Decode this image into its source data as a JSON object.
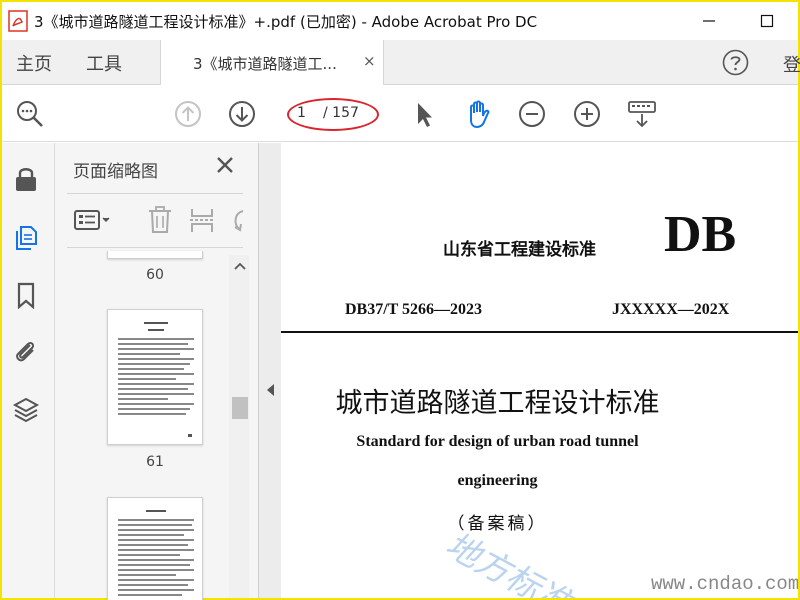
{
  "window": {
    "title": "3《城市道路隧道工程设计标准》+.pdf  (已加密)  - Adobe Acrobat Pro DC",
    "minimize_icon": "minimize-icon",
    "maximize_icon": "maximize-icon"
  },
  "tabs": {
    "home": "主页",
    "tools": "工具",
    "document": "3《城市道路隧道工...",
    "close": "×",
    "signin": "登"
  },
  "toolbar": {
    "page_current": "1",
    "page_total": "/ 157",
    "highlight_color": "#d9262d",
    "hand_color": "#1473e6"
  },
  "thumbnails_panel": {
    "title": "页面缩略图",
    "pages": [
      {
        "label": "60"
      },
      {
        "label": "61"
      },
      {
        "label": ""
      }
    ]
  },
  "document": {
    "standard_cn": "山东省工程建设标准",
    "db": "DB",
    "code_left": "DB37/T 5266—2023",
    "code_right": "JXXXXX—202X",
    "title_cn": "城市道路隧道工程设计标准",
    "title_en_line1": "Standard for design of urban road tunnel",
    "title_en_line2": "engineering",
    "draft": "（备案稿）",
    "watermark": "地方标准 ",
    "watermark_url": "www.cndao.com"
  },
  "colors": {
    "accent_blue": "#1473e6",
    "frame_yellow": "#f2e400"
  }
}
